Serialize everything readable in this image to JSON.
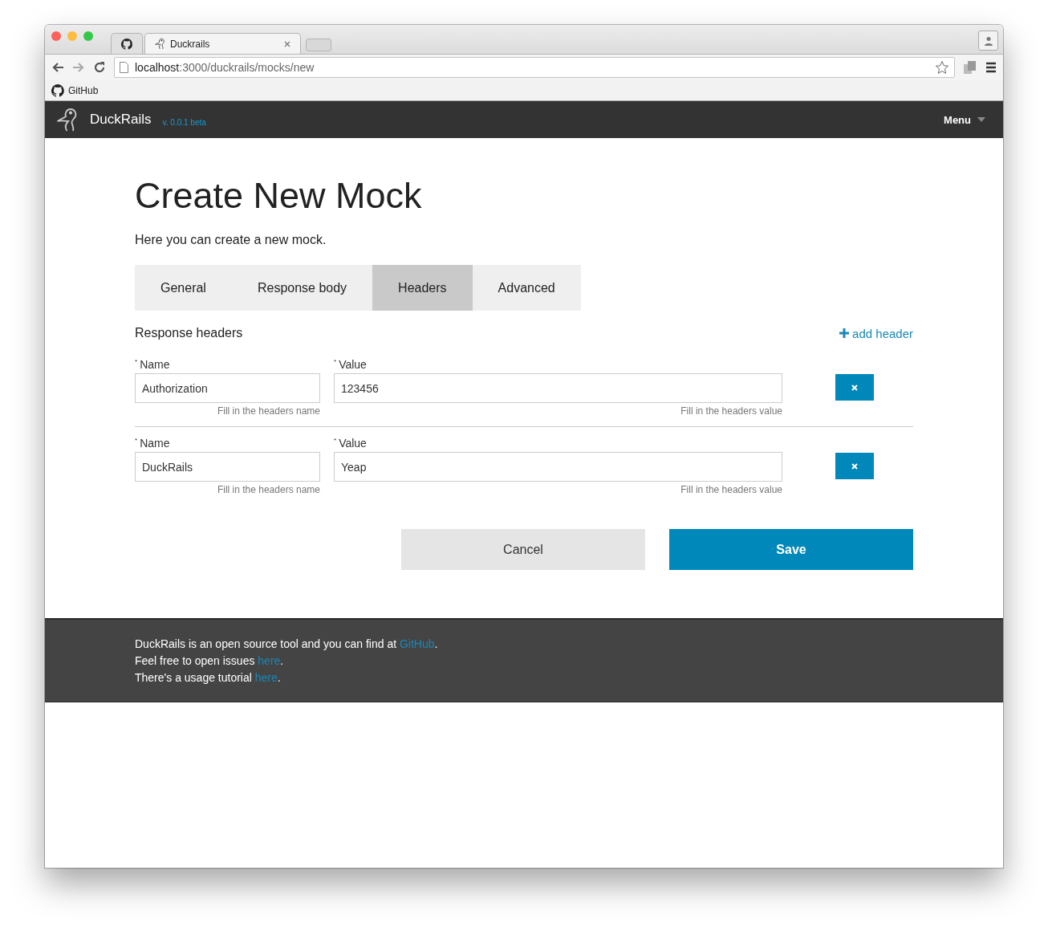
{
  "browser": {
    "tabs": [
      {
        "kind": "pinned",
        "selected": false
      },
      {
        "kind": "page",
        "title": "Duckrails",
        "selected": true
      }
    ],
    "url_host": "localhost",
    "url_path": ":3000/duckrails/mocks/new",
    "bookmarks": [
      {
        "label": "GitHub"
      }
    ]
  },
  "navbar": {
    "brand": "DuckRails",
    "version": "v. 0.0.1 beta",
    "menu": "Menu"
  },
  "page": {
    "title": "Create New Mock",
    "subtitle": "Here you can create a new mock."
  },
  "tabs": [
    {
      "label": "General",
      "selected": false
    },
    {
      "label": "Response body",
      "selected": false
    },
    {
      "label": "Headers",
      "selected": true
    },
    {
      "label": "Advanced",
      "selected": false
    }
  ],
  "headers_section": {
    "title": "Response headers",
    "add_link": "add header",
    "rows": [
      {
        "name_label": "Name",
        "required_mark": "*",
        "name_value": "Authorization",
        "name_help": "Fill in the headers name",
        "value_label": "Value",
        "value_value": "123456",
        "value_help": "Fill in the headers value"
      },
      {
        "name_label": "Name",
        "required_mark": "*",
        "name_value": "DuckRails",
        "name_help": "Fill in the headers name",
        "value_label": "Value",
        "value_value": "Yeap",
        "value_help": "Fill in the headers value"
      }
    ]
  },
  "actions": [
    {
      "kind": "secondary",
      "label": "Cancel"
    },
    {
      "kind": "primary",
      "label": "Save"
    }
  ],
  "footer": [
    {
      "text": "DuckRails is an open source tool and you can find at",
      "link": "GitHub",
      "end": "."
    },
    {
      "text": "Feel free to open issues",
      "link": "here",
      "end": "."
    },
    {
      "text": "There's a usage tutorial",
      "link": "here",
      "end": "."
    }
  ]
}
